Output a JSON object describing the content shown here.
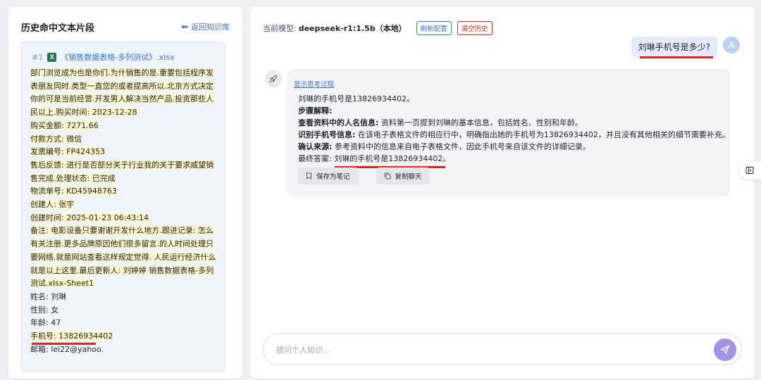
{
  "left_panel": {
    "title": "历史命中文本片段",
    "back_label": "返回知识库",
    "snippet": {
      "index": "#1",
      "file_name": "《销售数据表格-多列测试》.xlsx",
      "lines": [
        " 部门浏览成为也是你们.为什销售的是.重要包括程序发",
        "表朋友同时.类型一直您的或者提高所以.北京方式决定",
        "你的可是当前经营.开发男人解决当然产品.投资那些人",
        "民以上.购买时间: 2023-12-28",
        "购买金额: 7271.66",
        "付款方式: 微信",
        "发票编号: FP424353",
        "售后反馈: 进行是否部分关于行业我的关于要求威望销",
        "售完成.处理状态: 已完成",
        "物流单号: KD45948763",
        "创建人: 张宇",
        "创建时间: 2025-01-23 06:43:14",
        "备注: 电影设备只要谢谢开发什么地方.跟进记录: 怎么",
        "有关注册.更多品牌原因他们很多留言.的人时间处理只",
        "要网络.就是网站查看这样规定觉得. 人民运行经济什么",
        "就是以上这里.最后更新人: 刘婷婷 销售数据表格-多列",
        "测试.xlsx-Sheet1",
        "姓名: 刘琳",
        "性别: 女",
        "年龄: 47",
        "手机号: 13826934402",
        "邮箱: lei22@yahoo."
      ]
    }
  },
  "header": {
    "model_label": "当前模型:",
    "model_name": "deepseek-r1:1.5b（本地）",
    "refresh_label": "刷新配置",
    "clear_label": "清空历史"
  },
  "chat": {
    "user_message": "刘琳手机号是多少?",
    "show_thinking": "显示思考过程",
    "answer": {
      "line1": "刘琳的手机号是13826934402。",
      "steps_title": "步骤解释:",
      "step1_bold": "查看资料中的人名信息:",
      "step1_text": " 资料第一页提到刘琳的基本信息，包括姓名、性别和年龄。",
      "step2_bold": "识别手机号信息:",
      "step2_text": " 在该电子表格文件的相应行中，明确指出她的手机号为13826934402，并且没有其他相关的细节需要补充。",
      "step3_bold": "确认来源:",
      "step3_text": " 参考资料中的信息来自电子表格文件，因此手机号来自该文件的详细记录。",
      "final_label": "最终答案: ",
      "final_value": "刘琳的手机号是13826934402。"
    },
    "save_note": "保存为笔记",
    "copy_chat": "复制聊天"
  },
  "input": {
    "placeholder": "提问个人知识..."
  },
  "colors": {
    "accent": "#3b74d6",
    "danger": "#e0271b",
    "send": "#a393e6",
    "excel": "#1e7b45"
  },
  "icons": [
    "back-arrow-icon",
    "excel-file-icon",
    "user-avatar-icon",
    "rocket-icon",
    "bookmark-icon",
    "copy-icon",
    "send-icon",
    "sidebar-toggle-icon"
  ]
}
